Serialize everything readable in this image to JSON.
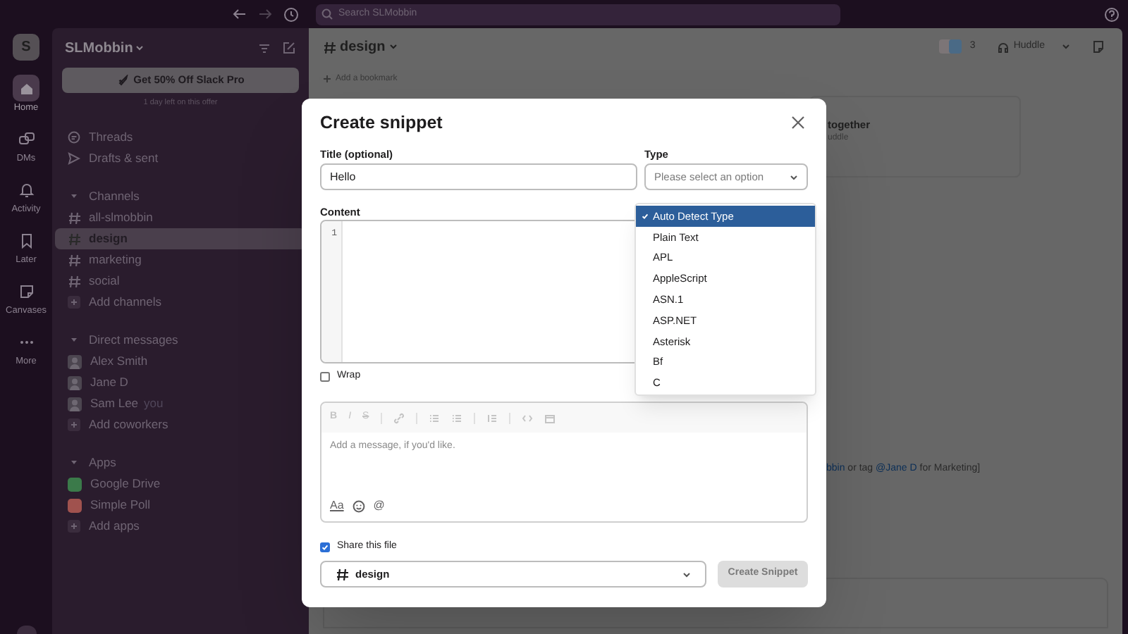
{
  "top_bar": {
    "search_placeholder": "Search SLMobbin"
  },
  "rail": {
    "workspace_initial": "S",
    "items": [
      {
        "label": "Home",
        "selected": true
      },
      {
        "label": "DMs",
        "selected": false
      },
      {
        "label": "Activity",
        "selected": false
      },
      {
        "label": "Later",
        "selected": false
      },
      {
        "label": "Canvases",
        "selected": false
      },
      {
        "label": "More",
        "selected": false
      }
    ]
  },
  "sidebar": {
    "workspace": "SLMobbin",
    "promo_button": "Get 50% Off Slack Pro",
    "promo_note": "1 day left on this offer",
    "links": [
      {
        "label": "Threads"
      },
      {
        "label": "Drafts & sent"
      }
    ],
    "sections": [
      {
        "title": "Channels",
        "expanded": true,
        "items": [
          {
            "kind": "channel",
            "label": "all-slmobbin",
            "selected": false
          },
          {
            "kind": "channel",
            "label": "design",
            "selected": true
          },
          {
            "kind": "channel",
            "label": "marketing",
            "selected": false
          },
          {
            "kind": "channel",
            "label": "social",
            "selected": false
          },
          {
            "kind": "add",
            "label": "Add channels",
            "selected": false
          }
        ]
      },
      {
        "title": "Direct messages",
        "expanded": true,
        "items": [
          {
            "kind": "person",
            "label": "Alex Smith",
            "selected": false
          },
          {
            "kind": "person",
            "label": "Jane D",
            "selected": false
          },
          {
            "kind": "person",
            "label": "Sam Lee",
            "suffix": "you",
            "selected": false
          },
          {
            "kind": "add",
            "label": "Add coworkers",
            "selected": false
          }
        ]
      },
      {
        "title": "Apps",
        "expanded": true,
        "items": [
          {
            "kind": "app",
            "label": "Google Drive",
            "color": "#3b7a4a",
            "selected": false
          },
          {
            "kind": "app",
            "label": "Simple Poll",
            "color": "#a0524e",
            "selected": false
          },
          {
            "kind": "add",
            "label": "Add apps",
            "selected": false
          }
        ]
      }
    ]
  },
  "main": {
    "channel": "design",
    "member_count": "3",
    "huddle": "Huddle",
    "bookmark": "Add a bookmark",
    "card_title": "together",
    "card_subtitle": "uddle",
    "message": [
      {
        "kind": "mention",
        "text": "bbin"
      },
      {
        "kind": "text",
        "text": " or tag "
      },
      {
        "kind": "mention",
        "text": "@Jane D"
      },
      {
        "kind": "text",
        "text": " for Marketing]"
      }
    ]
  },
  "modal": {
    "title": "Create snippet",
    "title_label": "Title (optional)",
    "title_value": "Hello",
    "type_label": "Type",
    "type_placeholder": "Please select an option",
    "type_options": [
      {
        "label": "Auto Detect Type",
        "selected": true
      },
      {
        "label": "Plain Text",
        "selected": false
      },
      {
        "label": "APL",
        "selected": false
      },
      {
        "label": "AppleScript",
        "selected": false
      },
      {
        "label": "ASN.1",
        "selected": false
      },
      {
        "label": "ASP.NET",
        "selected": false
      },
      {
        "label": "Asterisk",
        "selected": false
      },
      {
        "label": "Bf",
        "selected": false
      },
      {
        "label": "C",
        "selected": false
      }
    ],
    "content_label": "Content",
    "line_numbers": [
      "1"
    ],
    "wrap": {
      "label": "Wrap",
      "checked": false
    },
    "format_letters": [
      "B",
      "I",
      "S"
    ],
    "message_placeholder": "Add a message, if you'd like.",
    "text_style_button": "Aa",
    "mention_button": "@",
    "share": {
      "label": "Share this file",
      "checked": true
    },
    "share_channel": "design",
    "create_button": "Create Snippet"
  }
}
